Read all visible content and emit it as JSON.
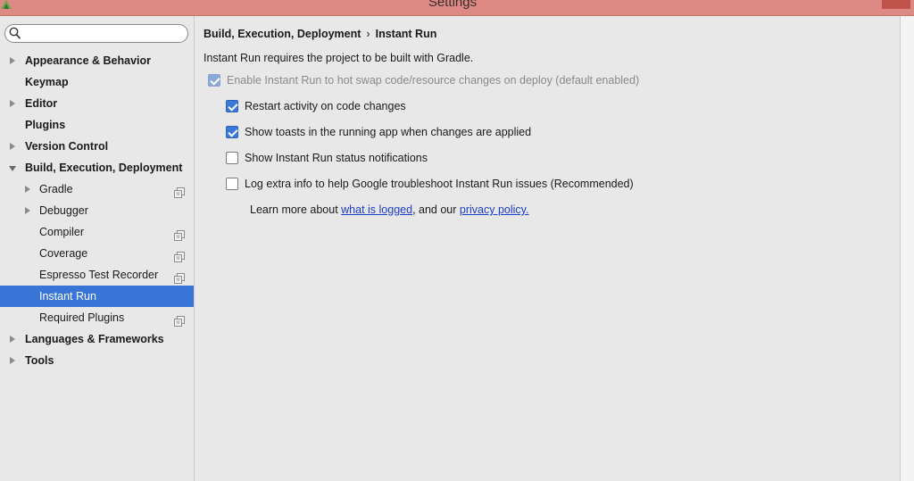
{
  "window": {
    "title": "Settings"
  },
  "search": {
    "placeholder": "",
    "value": ""
  },
  "sidebar": {
    "items": [
      {
        "label": "Appearance & Behavior",
        "level": 0,
        "arrow": "right"
      },
      {
        "label": "Keymap",
        "level": 0,
        "arrow": "none"
      },
      {
        "label": "Editor",
        "level": 0,
        "arrow": "right"
      },
      {
        "label": "Plugins",
        "level": 0,
        "arrow": "none"
      },
      {
        "label": "Version Control",
        "level": 0,
        "arrow": "right"
      },
      {
        "label": "Build, Execution, Deployment",
        "level": 0,
        "arrow": "down"
      },
      {
        "label": "Gradle",
        "level": 1,
        "arrow": "right",
        "copy": true
      },
      {
        "label": "Debugger",
        "level": 1,
        "arrow": "right",
        "copy": false
      },
      {
        "label": "Compiler",
        "level": 1,
        "arrow": "none",
        "copy": true
      },
      {
        "label": "Coverage",
        "level": 1,
        "arrow": "none",
        "copy": true
      },
      {
        "label": "Espresso Test Recorder",
        "level": 1,
        "arrow": "none",
        "copy": true
      },
      {
        "label": "Instant Run",
        "level": 1,
        "arrow": "none",
        "copy": false,
        "selected": true
      },
      {
        "label": "Required Plugins",
        "level": 1,
        "arrow": "none",
        "copy": true
      },
      {
        "label": "Languages & Frameworks",
        "level": 0,
        "arrow": "right"
      },
      {
        "label": "Tools",
        "level": 0,
        "arrow": "right"
      }
    ]
  },
  "content": {
    "breadcrumb": {
      "parent": "Build, Execution, Deployment",
      "separator": "›",
      "current": "Instant Run"
    },
    "intro": "Instant Run requires the project to be built with Gradle.",
    "options": [
      {
        "label": "Enable Instant Run to hot swap code/resource changes on deploy (default enabled)",
        "checked": true,
        "disabled": true
      },
      {
        "label": "Restart activity on code changes",
        "checked": true,
        "disabled": false
      },
      {
        "label": "Show toasts in the running app when changes are applied",
        "checked": true,
        "disabled": false
      },
      {
        "label": "Show Instant Run status notifications",
        "checked": false,
        "disabled": false
      },
      {
        "label": "Log extra info to help Google troubleshoot Instant Run issues (Recommended)",
        "checked": false,
        "disabled": false
      }
    ],
    "learn_more": {
      "prefix": "Learn more about ",
      "link1": "what is logged",
      "middle": ", and our ",
      "link2": "privacy policy."
    }
  },
  "colors": {
    "titlebar": "#dd8a84",
    "selection": "#3875d6",
    "checkbox": "#3a79d8",
    "link": "#1a3dc8"
  }
}
